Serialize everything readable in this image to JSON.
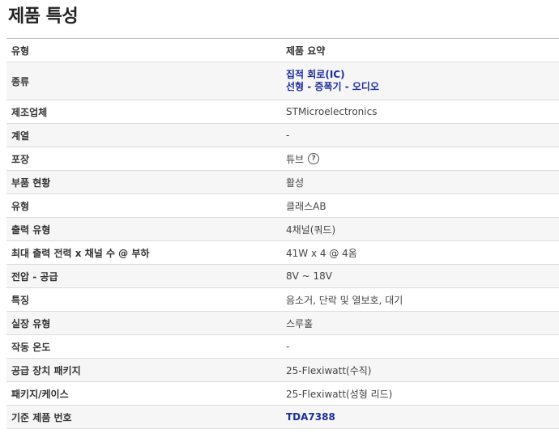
{
  "page_title": "제품 특성",
  "table": {
    "header": {
      "label": "유형",
      "value": "제품 요약"
    },
    "rows": [
      {
        "label": "종류",
        "value_link_1": "집적 회로(IC)",
        "value_link_2": "선형 - 증폭기 - 오디오"
      },
      {
        "label": "제조업체",
        "value": "STMicroelectronics"
      },
      {
        "label": "계열",
        "value": "-"
      },
      {
        "label": "포장",
        "value": "튜브",
        "icon": "help-icon",
        "icon_glyph": "?"
      },
      {
        "label": "부품 현황",
        "value": "활성"
      },
      {
        "label": "유형",
        "value": "클래스AB"
      },
      {
        "label": "출력 유형",
        "value": "4채널(쿼드)"
      },
      {
        "label": "최대 출력 전력 x 채널 수 @ 부하",
        "value": "41W x 4 @ 4옴"
      },
      {
        "label": "전압 - 공급",
        "value": "8V ~ 18V"
      },
      {
        "label": "특징",
        "value": "음소거, 단락 및 열보호, 대기"
      },
      {
        "label": "실장 유형",
        "value": "스루홀"
      },
      {
        "label": "작동 온도",
        "value": "-"
      },
      {
        "label": "공급 장치 패키지",
        "value": "25-Flexiwatt(수직)"
      },
      {
        "label": "패키지/케이스",
        "value": "25-Flexiwatt(성형 리드)"
      },
      {
        "label": "기준 제품 번호",
        "value_link": "TDA7388"
      }
    ]
  },
  "colors": {
    "link": "#1d2e9c",
    "row_shade": "#f6f6f6",
    "border": "#dcdcdc"
  }
}
